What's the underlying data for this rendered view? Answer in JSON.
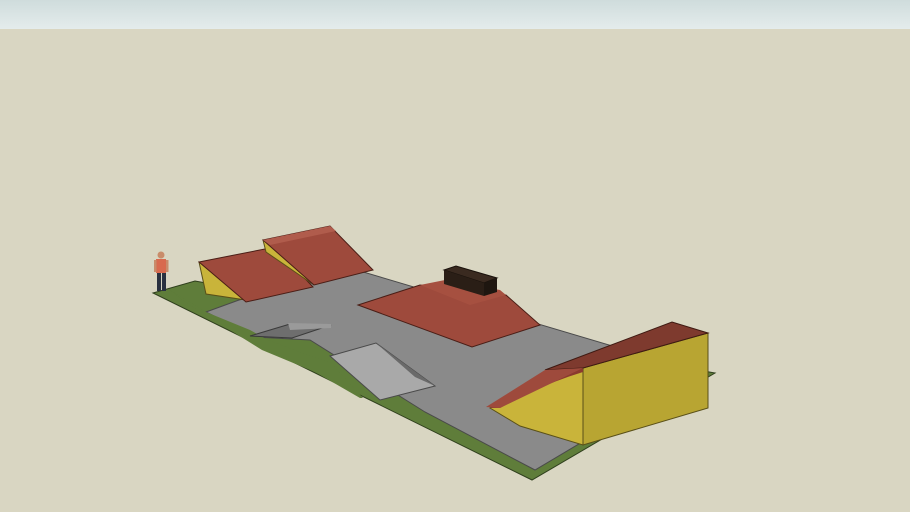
{
  "viewer": {
    "colors": {
      "sky_top": "#cfdcdc",
      "sky_bottom": "#e4ecec",
      "ground": "#d9d6c2",
      "grass": "#5f7d3a",
      "concrete": "#8a8a8a",
      "ramp_top": "#9e4a3c",
      "ramp_side": "#c9b43a",
      "box_top": "#3a2a20"
    }
  },
  "model": {
    "objects": [
      "grass-base",
      "concrete-slab",
      "double-quarter-pipe",
      "funbox-with-ledge",
      "kicker-ramp",
      "launch-ramp",
      "quarter-pipe-deck",
      "scale-figure"
    ]
  }
}
